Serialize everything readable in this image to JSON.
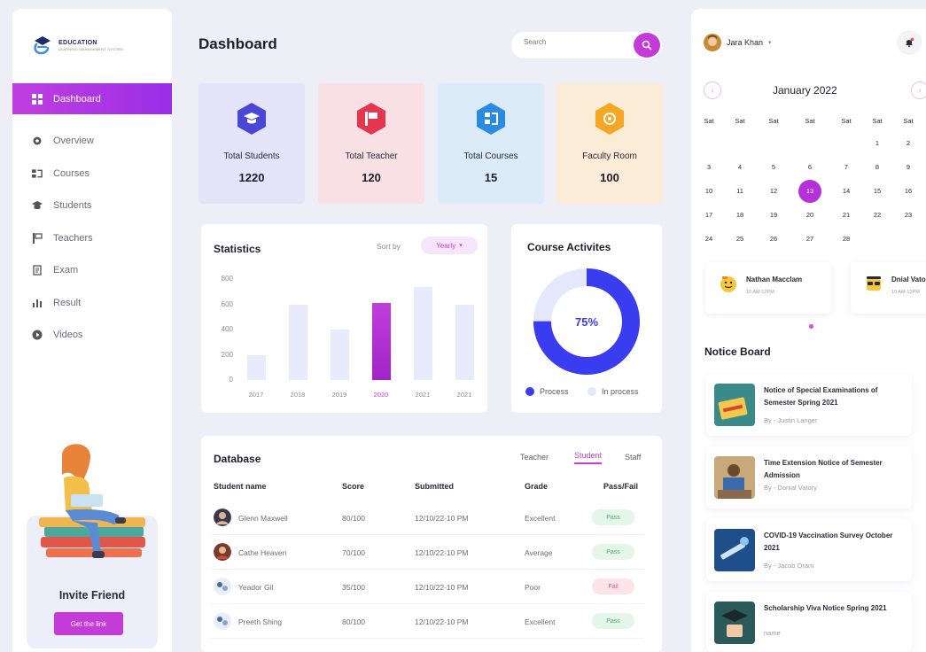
{
  "brand": {
    "name": "EDUCATION",
    "tagline": "LEARNING MANAGEMENT SYSTEM"
  },
  "sidebar": {
    "items": [
      {
        "label": "Dashboard",
        "icon": "grid-icon",
        "active": true
      },
      {
        "label": "Overview",
        "icon": "gear-icon"
      },
      {
        "label": "Courses",
        "icon": "courses-icon"
      },
      {
        "label": "Students",
        "icon": "graduation-cap-icon"
      },
      {
        "label": "Teachers",
        "icon": "teacher-icon"
      },
      {
        "label": "Exam",
        "icon": "exam-icon"
      },
      {
        "label": "Result",
        "icon": "bar-chart-icon"
      },
      {
        "label": "Videos",
        "icon": "play-icon"
      }
    ],
    "invite": {
      "title": "Invite Friend",
      "button": "Get the link"
    }
  },
  "header": {
    "title": "Dashboard",
    "search_placeholder": "Search"
  },
  "stats": [
    {
      "label": "Total Students",
      "value": "1220",
      "icon": "graduation-cap-icon",
      "bg": "#e4e3f8",
      "color": "#4b47d6"
    },
    {
      "label": "Total Teacher",
      "value": "120",
      "icon": "teacher-icon",
      "bg": "#f9e0e5",
      "color": "#e5354f"
    },
    {
      "label": "Total Courses",
      "value": "15",
      "icon": "courses-icon",
      "bg": "#dcebf8",
      "color": "#2b8be3"
    },
    {
      "label": "Faculty Room",
      "value": "100",
      "icon": "room-icon",
      "bg": "#fbecd8",
      "color": "#f5a623"
    }
  ],
  "statistics": {
    "title": "Statistics",
    "sort_label": "Sort by",
    "sort_value": "Yearly"
  },
  "chart_data": {
    "type": "bar",
    "title": "Statistics",
    "categories": [
      "2017",
      "2018",
      "2019",
      "2020",
      "2021",
      "2021"
    ],
    "values": [
      200,
      600,
      400,
      610,
      740,
      600
    ],
    "highlight": "2020",
    "yticks": [
      "800",
      "600",
      "400",
      "200",
      "0"
    ],
    "ylim": [
      0,
      800
    ],
    "colors": {
      "bar": "#e7ebfb",
      "highlight": "#b932d6"
    }
  },
  "course_activities": {
    "title": "Course Activites",
    "percent": "75%",
    "value": 75,
    "legend": [
      {
        "label": "Process",
        "color": "#3a3cf0"
      },
      {
        "label": "In process",
        "color": "#e5e8fb"
      }
    ]
  },
  "database": {
    "title": "Database",
    "tabs": [
      "Teacher",
      "Student",
      "Staff"
    ],
    "active_tab": "Student",
    "columns": [
      "Student name",
      "Score",
      "Submitted",
      "Grade",
      "Pass/Fail"
    ],
    "rows": [
      {
        "name": "Glenn Maxwell",
        "score": "80/100",
        "submitted": "12/10/22-10 PM",
        "grade": "Excellent",
        "status": "Pass"
      },
      {
        "name": "Cathe Heaven",
        "score": "70/100",
        "submitted": "12/10/22-10 PM",
        "grade": "Average",
        "status": "Pass"
      },
      {
        "name": "Yeador Gil",
        "score": "35/100",
        "submitted": "12/10/22-10 PM",
        "grade": "Poor",
        "status": "Fail"
      },
      {
        "name": "Preeth Shing",
        "score": "80/100",
        "submitted": "12/10/22-10 PM",
        "grade": "Excellent",
        "status": "Pass"
      }
    ]
  },
  "user": {
    "name": "Jara Khan"
  },
  "calendar": {
    "title": "January 2022",
    "weekdays": [
      "Sat",
      "Sat",
      "Sat",
      "Sat",
      "Sat",
      "Sat",
      "Sat"
    ],
    "weeks": [
      [
        "",
        "",
        "",
        "",
        "",
        "1",
        "2"
      ],
      [
        "3",
        "4",
        "5",
        "6",
        "7",
        "8",
        "9"
      ],
      [
        "10",
        "11",
        "12",
        "13",
        "14",
        "15",
        "16"
      ],
      [
        "17",
        "18",
        "19",
        "20",
        "21",
        "22",
        "23"
      ],
      [
        "24",
        "25",
        "26",
        "27",
        "28",
        "",
        ""
      ]
    ],
    "selected": "13"
  },
  "events": [
    {
      "name": "Nathan Macclam",
      "time": "10 AM-12PM",
      "icon": "emoji-icon"
    },
    {
      "name": "Dnial Vato",
      "time": "10 AM-12PM",
      "icon": "sunglasses-icon"
    }
  ],
  "notice_board": {
    "title": "Notice Board",
    "items": [
      {
        "title": "Notice of Special Examinations of Semester Spring 2021",
        "by": "By - Justin Langer"
      },
      {
        "title": "Time Extension Notice of Semester Admission",
        "by": "By - Donial Vatory"
      },
      {
        "title": "COVID-19 Vaccination Survey October 2021",
        "by": "By - Jacob Oram"
      },
      {
        "title": "Scholarship Viva Notice Spring 2021",
        "by": "name"
      }
    ]
  }
}
